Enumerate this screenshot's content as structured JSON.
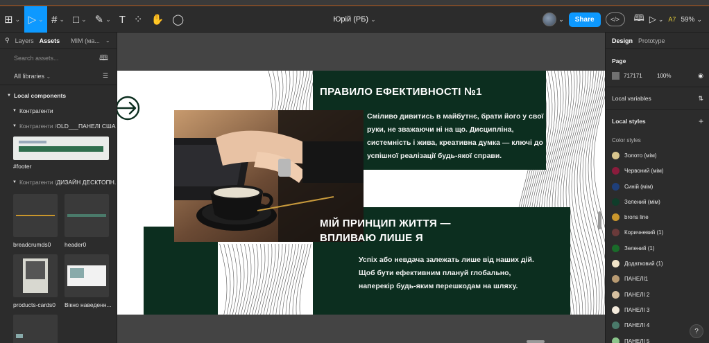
{
  "toolbar": {
    "tools": [
      {
        "name": "main-menu",
        "glyph": "⊞"
      },
      {
        "name": "move-tool",
        "glyph": "▷"
      },
      {
        "name": "frame-tool",
        "glyph": "#"
      },
      {
        "name": "shape-tool",
        "glyph": "□"
      },
      {
        "name": "pen-tool",
        "glyph": "✎"
      },
      {
        "name": "text-tool",
        "glyph": "T"
      },
      {
        "name": "resources-tool",
        "glyph": "⁘"
      },
      {
        "name": "hand-tool",
        "glyph": "✋"
      },
      {
        "name": "comment-tool",
        "glyph": "◯"
      }
    ],
    "file_title": "Юрій (РБ)",
    "share_label": "Share",
    "dev_mode_glyph": "</>",
    "book_icon": "📖",
    "present_glyph": "▷",
    "collab_label": "A7",
    "zoom": "59%"
  },
  "left_panel": {
    "search_glyph": "⚲",
    "tabs": [
      "Layers",
      "Assets",
      "MIM (ма..."
    ],
    "search_placeholder": "Search assets...",
    "libraries_label": "All libraries",
    "local_components": "Local components",
    "group1": "Контрагенти",
    "group2_prefix": "Контрагенти / ",
    "group2_name": "OLD___ПАНЕЛІ США ...",
    "footer_label": "#footer",
    "group3_prefix": "Контрагенти / ",
    "group3_name": "ДИЗАЙН ДЕСКТОПН...",
    "thumbs": [
      "breadcrumds0",
      "header0",
      "products-cards0",
      "Вікно наведенн..."
    ]
  },
  "canvas": {
    "heading1": "ПРАВИЛО ЕФЕКТИВНОСТІ №1",
    "paragraph1": "Сміливо дивитись в майбутнє, брати його у свої руки, не зважаючи ні на що. Дисципліна, системність і жива, креативна думка — ключі до успішної реалізації будь-якої справи.",
    "heading2": "МІЙ ПРИНЦИП ЖИТТЯ — ВПЛИВАЮ ЛИШЕ Я",
    "paragraph2": "Успіх або невдача залежать лише від наших дій. Щоб бути ефективним плануй глобально, наперекір будь-яким перешкодам на шляху."
  },
  "right_panel": {
    "tabs": [
      "Design",
      "Prototype"
    ],
    "page_label": "Page",
    "page_color": "717171",
    "page_opacity": "100%",
    "eye_glyph": "◉",
    "local_variables": "Local variables",
    "local_styles": "Local styles",
    "plus": "+",
    "color_styles_label": "Color styles",
    "styles": [
      {
        "name": "Золото (мім)",
        "color": "#d8c58e"
      },
      {
        "name": "Червоний (мім)",
        "color": "#8a1c3c"
      },
      {
        "name": "Синій (мім)",
        "color": "#1f3f7a"
      },
      {
        "name": "Зелений (мім)",
        "color": "#0f3d2a"
      },
      {
        "name": "brons line",
        "color": "#c9962c"
      },
      {
        "name": "Коричневий (1)",
        "color": "#6a3a3a"
      },
      {
        "name": "Зелений (1)",
        "color": "#1a6b2a"
      },
      {
        "name": "Додатковий (1)",
        "color": "#f1e4c8"
      },
      {
        "name": "ПАНЕЛІ1",
        "color": "#b89a72"
      },
      {
        "name": "ПАНЕЛІ 2",
        "color": "#d6c0a0"
      },
      {
        "name": "ПАНЕЛІ 3",
        "color": "#f3eadc"
      },
      {
        "name": "ПАНЕЛІ 4",
        "color": "#4a7a6a"
      },
      {
        "name": "ПАНЕЛІ 5",
        "color": "#8ac48a"
      }
    ],
    "help_glyph": "?"
  }
}
